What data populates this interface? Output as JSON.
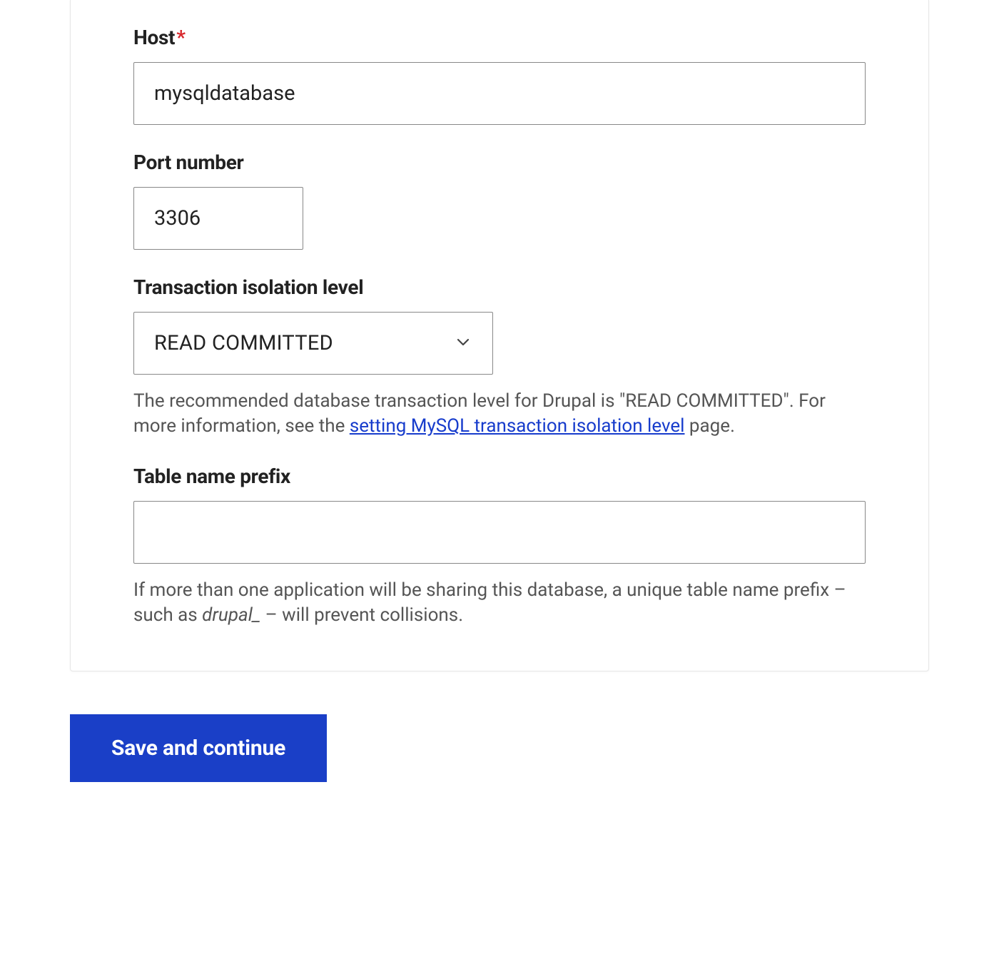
{
  "form": {
    "host": {
      "label": "Host",
      "required_mark": "*",
      "value": "mysqldatabase"
    },
    "port": {
      "label": "Port number",
      "value": "3306"
    },
    "isolation": {
      "label": "Transaction isolation level",
      "value": "READ COMMITTED",
      "help_before_link": "The recommended database transaction level for Drupal is \"READ COMMITTED\". For more information, see the ",
      "help_link_text": "setting MySQL transaction isolation level",
      "help_after_link": " page."
    },
    "prefix": {
      "label": "Table name prefix",
      "value": "",
      "help_before_em": "If more than one application will be sharing this database, a unique table name prefix – such as ",
      "help_em": "drupal_",
      "help_after_em": " – will prevent collisions."
    }
  },
  "actions": {
    "submit_label": "Save and continue"
  }
}
